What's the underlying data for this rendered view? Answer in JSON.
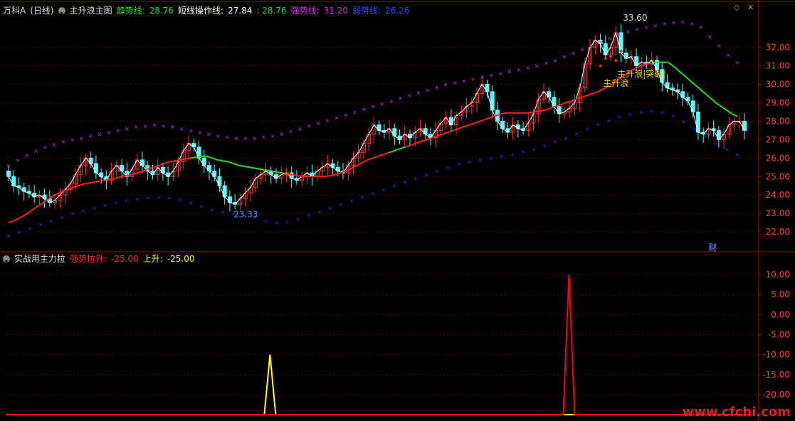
{
  "header_main": {
    "stock": "万科A",
    "period": "(日线)",
    "indicator": "主升浪主图",
    "trend_label": "趋势线:",
    "trend_value": "28.76",
    "short_label": "短线操作线:",
    "short_value": "27.84",
    "unnamed_value": ": 28.76",
    "strong_label": "强势线:",
    "strong_value": "31.20",
    "weak_label": "弱势线:",
    "weak_value": "26.26"
  },
  "header_sub": {
    "indicator": "实战用主力拉",
    "pull_label": "强势拉升:",
    "pull_value": "-25.00",
    "rise_label": "上升:",
    "rise_value": "-25.00"
  },
  "annotations": {
    "high_label": "33.60",
    "low_label": "23.33",
    "wave_label": "主升浪",
    "breakout_label": "主升浪|突破|",
    "cai_label": "财"
  },
  "watermark": "www.cfchi.com",
  "colors": {
    "up": "#ff3232",
    "down": "#54ffff",
    "ma_red": "#ff2020",
    "ma_green": "#20e020",
    "upper_band": "#c030ff",
    "lower_band": "#3030ff",
    "grid": "#600000",
    "axis": "#b00000",
    "price_line": "#ffffff",
    "yellow_spike": "#ffff00",
    "red_spike": "#ff0000"
  },
  "chart_data": [
    {
      "type": "candlestick",
      "title": "主升浪主图",
      "yticks": [
        22.0,
        23.0,
        24.0,
        25.0,
        26.0,
        27.0,
        28.0,
        29.0,
        30.0,
        31.0,
        32.0
      ],
      "ylim": [
        21.0,
        33.8
      ],
      "grid": true,
      "closes": [
        25.0,
        24.5,
        24.4,
        24.2,
        24.1,
        23.9,
        24.0,
        23.8,
        23.6,
        23.7,
        24.0,
        24.3,
        24.6,
        25.1,
        25.6,
        26.0,
        25.7,
        25.2,
        25.0,
        24.8,
        25.3,
        25.6,
        25.3,
        25.0,
        25.4,
        25.9,
        25.6,
        25.3,
        25.1,
        25.5,
        25.2,
        25.0,
        25.3,
        25.8,
        26.4,
        26.8,
        26.6,
        26.0,
        25.6,
        25.3,
        25.0,
        24.5,
        23.9,
        23.6,
        23.5,
        23.8,
        24.1,
        24.4,
        24.9,
        25.1,
        25.3,
        25.1,
        24.9,
        25.1,
        25.2,
        24.9,
        24.8,
        25.0,
        25.2,
        25.0,
        25.3,
        25.5,
        25.7,
        25.5,
        25.3,
        25.2,
        25.6,
        26.0,
        26.3,
        26.8,
        27.3,
        27.8,
        27.5,
        27.4,
        27.6,
        27.2,
        27.0,
        27.3,
        27.1,
        27.4,
        27.6,
        27.3,
        27.1,
        27.5,
        27.9,
        28.2,
        27.8,
        28.3,
        28.5,
        28.8,
        29.0,
        29.5,
        30.0,
        29.6,
        28.6,
        28.0,
        27.6,
        27.4,
        27.8,
        27.6,
        27.5,
        27.9,
        28.4,
        29.2,
        29.6,
        29.3,
        28.8,
        28.4,
        28.5,
        28.7,
        29.0,
        29.8,
        31.1,
        32.0,
        32.4,
        32.2,
        31.6,
        32.0,
        32.8,
        31.7,
        31.4,
        31.5,
        31.0,
        31.2,
        31.1,
        31.3,
        30.8,
        30.1,
        29.8,
        29.7,
        29.6,
        29.3,
        29.1,
        28.5,
        27.4,
        27.3,
        27.6,
        27.5,
        27.0,
        27.3,
        27.8,
        28.0,
        28.0,
        27.5
      ],
      "ma_line": [
        22.5,
        22.6,
        22.75,
        22.9,
        23.1,
        23.3,
        23.5,
        23.7,
        23.9,
        24.05,
        24.2,
        24.3,
        24.4,
        24.5,
        24.6,
        24.65,
        24.7,
        24.75,
        24.8,
        24.85,
        24.9,
        25.0,
        25.05,
        25.1,
        25.2,
        25.3,
        25.4,
        25.5,
        25.6,
        25.7,
        25.8,
        25.85,
        25.9,
        25.95,
        26.0,
        26.05,
        26.1,
        26.1,
        26.0,
        25.9,
        25.85,
        25.8,
        25.7,
        25.6,
        25.55,
        25.5,
        25.45,
        25.4,
        25.35,
        25.3,
        25.25,
        25.2,
        25.15,
        25.1,
        25.05,
        25.0,
        25.0,
        25.0,
        25.0,
        25.0,
        25.05,
        25.1,
        25.2,
        25.3,
        25.45,
        25.6,
        25.75,
        25.9,
        26.0,
        26.1,
        26.2,
        26.3,
        26.4,
        26.5,
        26.6,
        26.7,
        26.8,
        26.9,
        27.0,
        27.1,
        27.2,
        27.3,
        27.4,
        27.5,
        27.6,
        27.7,
        27.8,
        27.9,
        28.0,
        28.1,
        28.2,
        28.3,
        28.4,
        28.45,
        28.45,
        28.45,
        28.45,
        28.45,
        28.5,
        28.55,
        28.6,
        28.7,
        28.8,
        28.9,
        29.0,
        29.1,
        29.2,
        29.3,
        29.4,
        29.5,
        29.6,
        29.75,
        29.9,
        30.1,
        30.3,
        30.5,
        30.7,
        30.85,
        31.0,
        31.1,
        31.15,
        31.2,
        31.2,
        31.2,
        31.0,
        30.75,
        30.5,
        30.25,
        30.0,
        29.75,
        29.5,
        29.25,
        29.0,
        28.8,
        28.6,
        28.4,
        28.25
      ],
      "ma_color_split": {
        "green_ranges": [
          [
            34,
            52
          ],
          [
            71,
            74
          ],
          [
            120,
            140
          ]
        ]
      },
      "upper_band": [
        25.6,
        25.9,
        26.15,
        26.4,
        26.6,
        26.75,
        26.9,
        27.0,
        27.1,
        27.2,
        27.3,
        27.4,
        27.5,
        27.6,
        27.7,
        27.75,
        27.8,
        27.75,
        27.7,
        27.6,
        27.5,
        27.4,
        27.3,
        27.2,
        27.15,
        27.1,
        27.1,
        27.1,
        27.15,
        27.2,
        27.3,
        27.45,
        27.6,
        27.75,
        27.9,
        28.05,
        28.2,
        28.35,
        28.5,
        28.65,
        28.8,
        28.95,
        29.1,
        29.25,
        29.4,
        29.55,
        29.7,
        29.85,
        30.0,
        30.1,
        30.2,
        30.3,
        30.4,
        30.5,
        30.6,
        30.7,
        30.8,
        30.9,
        31.0,
        31.15,
        31.3,
        31.5,
        31.7,
        31.9,
        32.1,
        32.3,
        32.5,
        32.7,
        32.85,
        33.0,
        33.1,
        33.2,
        33.3,
        33.35,
        33.4,
        33.3,
        33.1,
        32.6,
        32.1,
        31.6,
        31.2
      ],
      "lower_band": [
        21.8,
        22.0,
        22.2,
        22.4,
        22.6,
        22.8,
        23.0,
        23.15,
        23.3,
        23.45,
        23.6,
        23.7,
        23.8,
        23.85,
        23.9,
        23.85,
        23.75,
        23.6,
        23.4,
        23.2,
        23.1,
        23.0,
        22.9,
        22.8,
        22.6,
        22.5,
        22.55,
        22.7,
        22.9,
        23.1,
        23.3,
        23.5,
        23.7,
        23.9,
        24.1,
        24.3,
        24.5,
        24.7,
        24.9,
        25.1,
        25.3,
        25.5,
        25.7,
        25.8,
        25.9,
        26.0,
        26.1,
        26.2,
        26.35,
        26.5,
        26.7,
        26.9,
        27.1,
        27.35,
        27.6,
        27.85,
        28.05,
        28.25,
        28.4,
        28.5,
        28.55,
        28.5,
        28.3,
        28.0,
        27.6,
        27.2,
        26.8,
        26.5,
        26.2
      ],
      "high_point": 33.6,
      "low_point": 23.33
    },
    {
      "type": "line",
      "title": "实战用主力拉",
      "yticks": [
        -20.0,
        -15.0,
        -10.0,
        -5.0,
        0.0,
        5.0,
        10.0
      ],
      "ylim": [
        -25.5,
        12.5
      ],
      "grid": true,
      "baseline": -25.0,
      "series": [
        {
          "name": "上升",
          "color": "#ffff00",
          "spike_at": 0.351,
          "spike_value": -10.0
        },
        {
          "name": "强势拉升",
          "color": "#ff0000",
          "spike_at": 0.748,
          "spike_value": 10.0
        }
      ]
    }
  ]
}
